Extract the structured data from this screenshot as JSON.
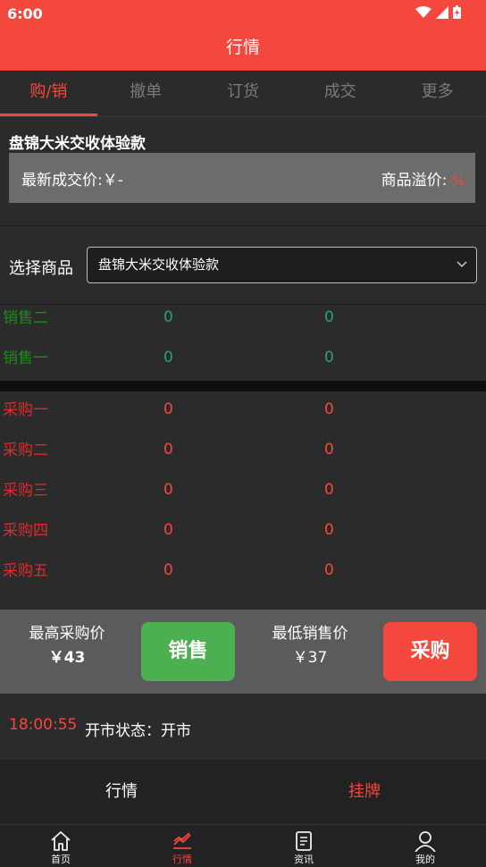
{
  "status_bar": {
    "time": "6:00"
  },
  "header": {
    "title": "行情"
  },
  "tabs": [
    {
      "label": "购/销",
      "active": true
    },
    {
      "label": "撤单",
      "active": false
    },
    {
      "label": "订货",
      "active": false
    },
    {
      "label": "成交",
      "active": false
    },
    {
      "label": "更多",
      "active": false
    }
  ],
  "product": {
    "name": "盘锦大米交收体验款",
    "latest_price_label": "最新成交价:",
    "latest_price_value": "￥-",
    "premium_label": "商品溢价:",
    "premium_value": "-%"
  },
  "selector": {
    "label": "选择商品",
    "value": "盘锦大米交收体验款"
  },
  "order_book": {
    "sell": [
      {
        "label": "销售二",
        "v1": "0",
        "v2": "0"
      },
      {
        "label": "销售一",
        "v1": "0",
        "v2": "0"
      }
    ],
    "buy": [
      {
        "label": "采购一",
        "v1": "0",
        "v2": "0"
      },
      {
        "label": "采购二",
        "v1": "0",
        "v2": "0"
      },
      {
        "label": "采购三",
        "v1": "0",
        "v2": "0"
      },
      {
        "label": "采购四",
        "v1": "0",
        "v2": "0"
      },
      {
        "label": "采购五",
        "v1": "0",
        "v2": "0"
      }
    ]
  },
  "actions": {
    "highest_buy_label": "最高采购价",
    "highest_buy_value": "￥43",
    "sell_button": "销售",
    "lowest_sell_label": "最低销售价",
    "lowest_sell_value": "￥37",
    "buy_button": "采购"
  },
  "market_status": {
    "clock": "18:00:55",
    "text": "开市状态：开市"
  },
  "sub_nav": [
    {
      "label": "行情",
      "active": false
    },
    {
      "label": "挂牌",
      "active": true
    }
  ],
  "bottom_nav": [
    {
      "label": "首页",
      "icon": "home-icon",
      "active": false
    },
    {
      "label": "行情",
      "icon": "chart-icon",
      "active": true
    },
    {
      "label": "资讯",
      "icon": "news-icon",
      "active": false
    },
    {
      "label": "我的",
      "icon": "user-icon",
      "active": false
    }
  ],
  "colors": {
    "accent": "#f4473e",
    "sell_green": "#4caf50",
    "background": "#2b2b2b"
  }
}
